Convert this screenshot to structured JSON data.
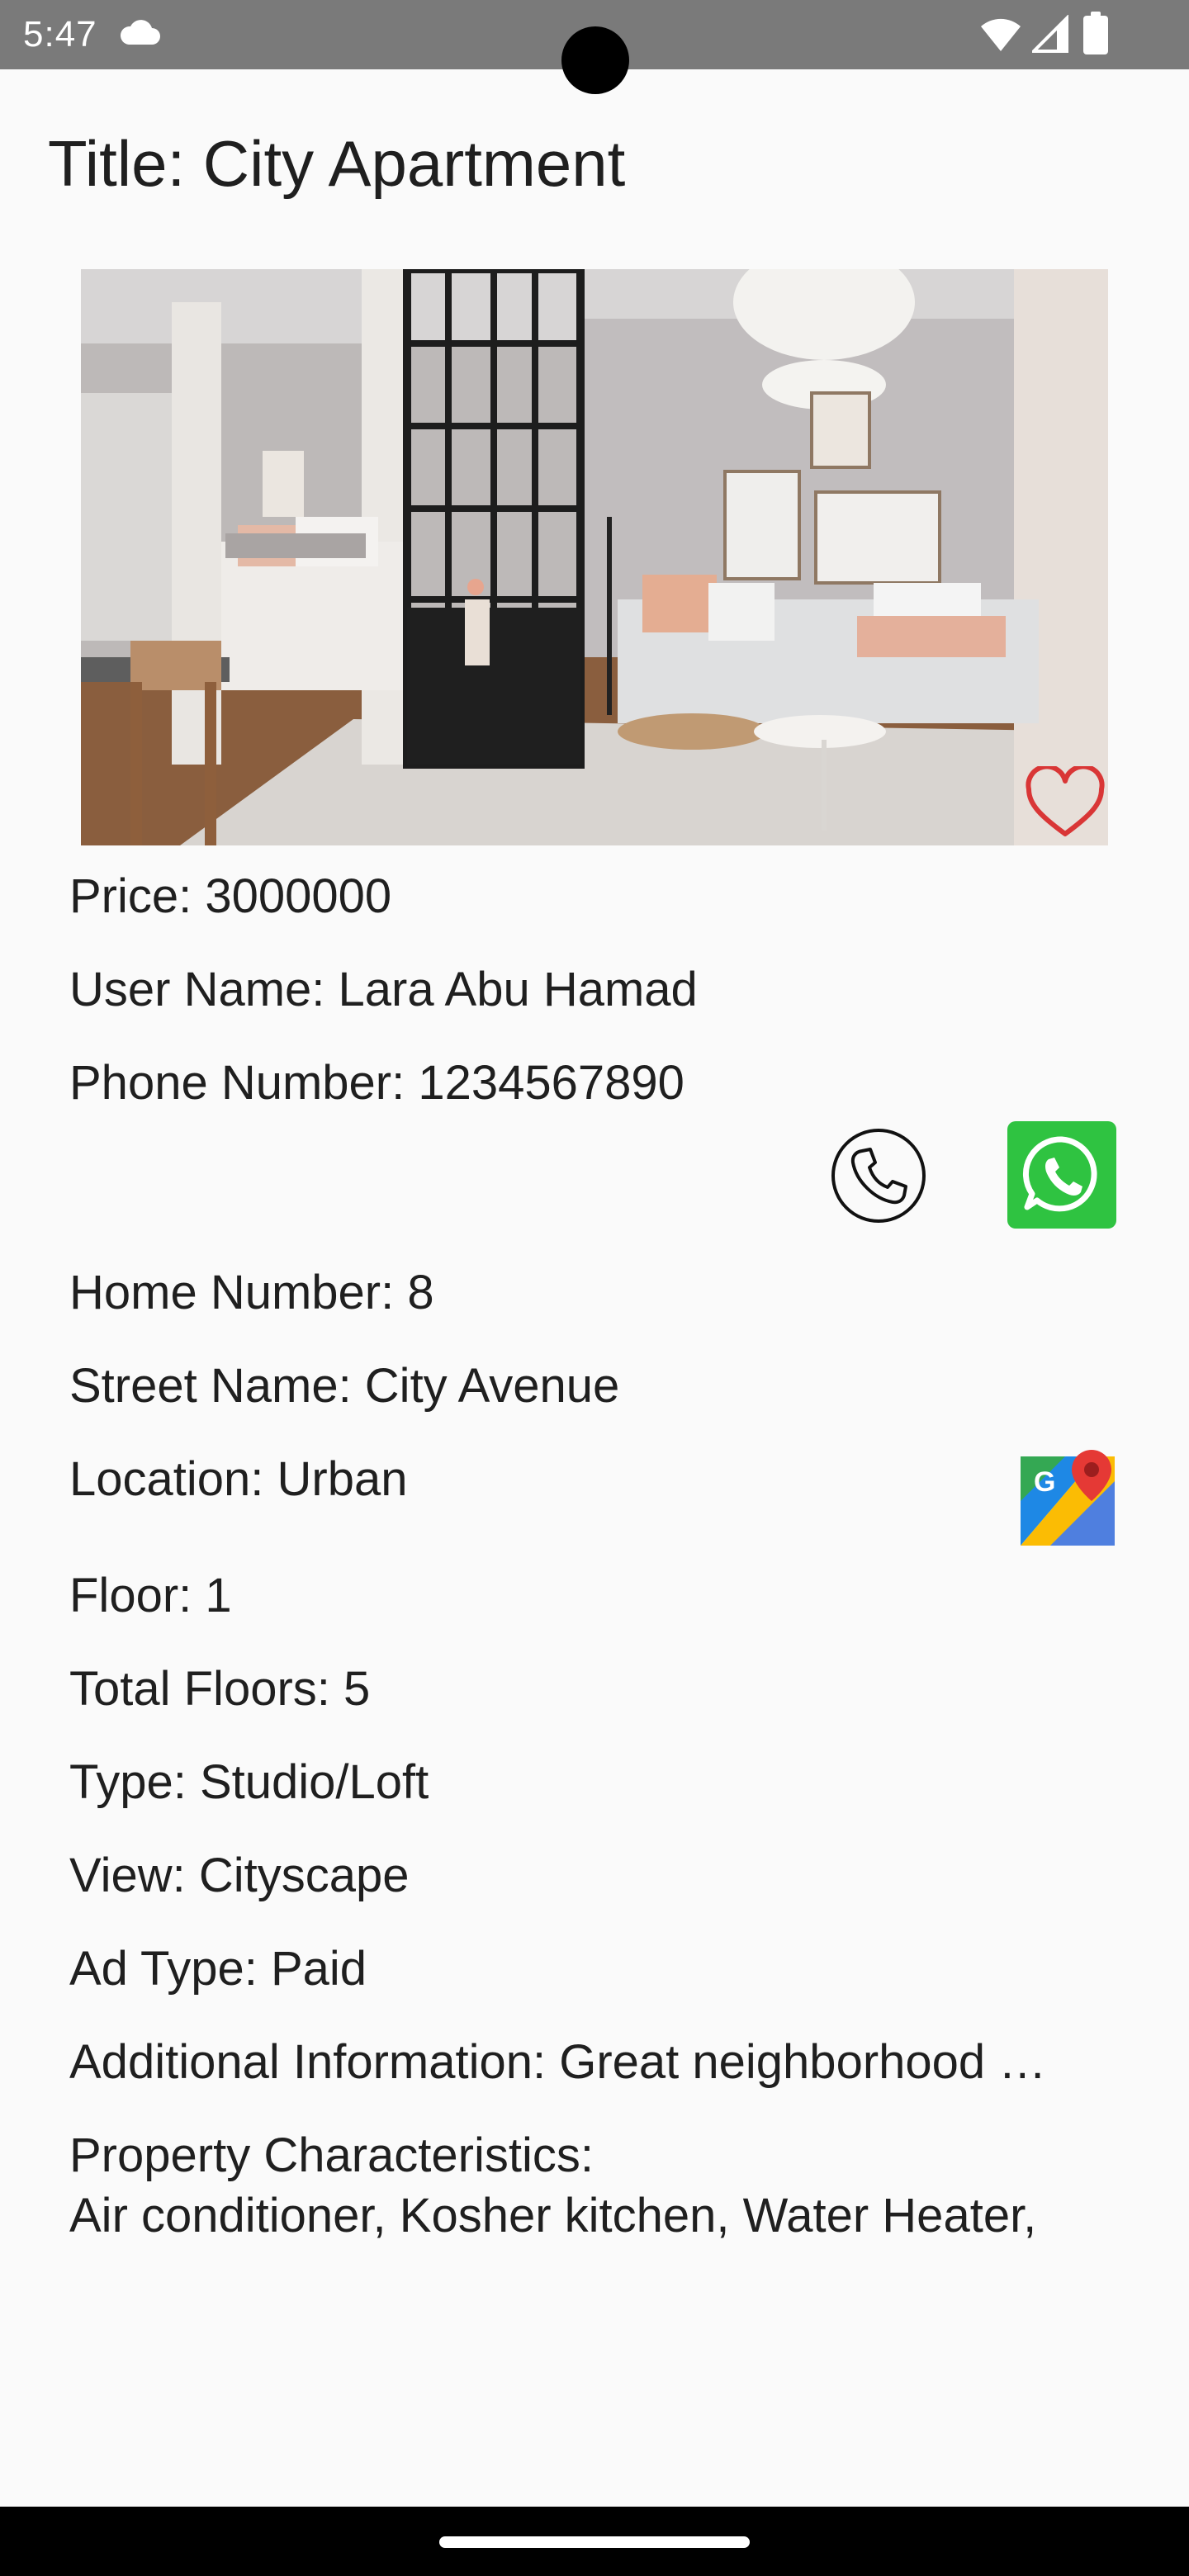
{
  "status_bar": {
    "time": "5:47",
    "icons": [
      "cloud-icon",
      "wifi-icon",
      "signal-icon",
      "battery-icon"
    ]
  },
  "listing": {
    "title": "Title: City Apartment",
    "photo_subject": "apartment-interior-photo",
    "favorite_icon": "heart-outline-icon",
    "price": "Price: 3000000",
    "user_name": "User Name: Lara Abu Hamad",
    "phone_number": "Phone Number: 1234567890",
    "home_number": "Home Number: 8",
    "street_name": "Street Name: City Avenue",
    "location": "Location: Urban",
    "floor": "Floor: 1",
    "total_floors": "Total Floors: 5",
    "type": "Type: Studio/Loft",
    "view": "View: Cityscape",
    "ad_type": "Ad Type: Paid",
    "additional_info": "Additional Information: Great neighborhood …",
    "characteristics_label": "Property Characteristics:",
    "characteristics_value": "Air conditioner, Kosher kitchen, Water Heater,"
  },
  "actions": {
    "call_icon": "phone-icon",
    "whatsapp_icon": "whatsapp-icon",
    "maps_icon": "google-maps-icon"
  },
  "colors": {
    "status_bar": "#7a7a7a",
    "background": "#fafafa",
    "text": "#1f1f1f",
    "favorite": "#d93636",
    "whatsapp": "#2fc341",
    "nav_bar": "#000000"
  }
}
